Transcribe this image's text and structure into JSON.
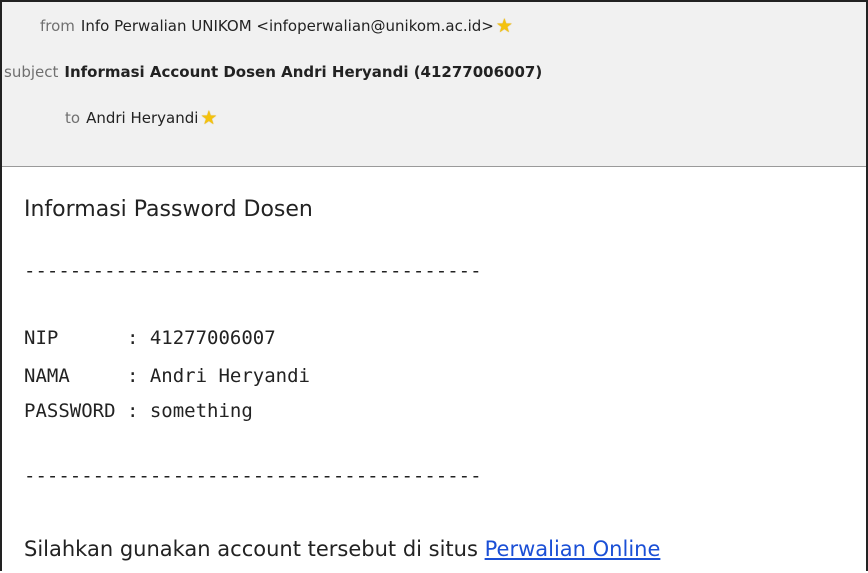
{
  "header": {
    "from_label": "from",
    "from_value": "Info Perwalian UNIKOM <infoperwalian@unikom.ac.id>",
    "subject_label": "subject",
    "subject_value": "Informasi Account Dosen Andri Heryandi (41277006007)",
    "to_label": "to",
    "to_value": "Andri Heryandi",
    "star_icon": "star-icon",
    "star_color": "#f4c20d"
  },
  "body": {
    "title": "Informasi Password Dosen",
    "separator_top": "----------------------------------------",
    "fields": [
      {
        "label": "NIP      ",
        "value": "41277006007"
      },
      {
        "label": "NAMA     ",
        "value": "Andri Heryandi"
      },
      {
        "label": "PASSWORD ",
        "value": "something"
      }
    ],
    "colon": ": ",
    "separator_bottom": "----------------------------------------",
    "closing_text": "Silahkan gunakan account tersebut di situs ",
    "link_text": "Perwalian Online",
    "link_color": "#1a4fd6"
  }
}
